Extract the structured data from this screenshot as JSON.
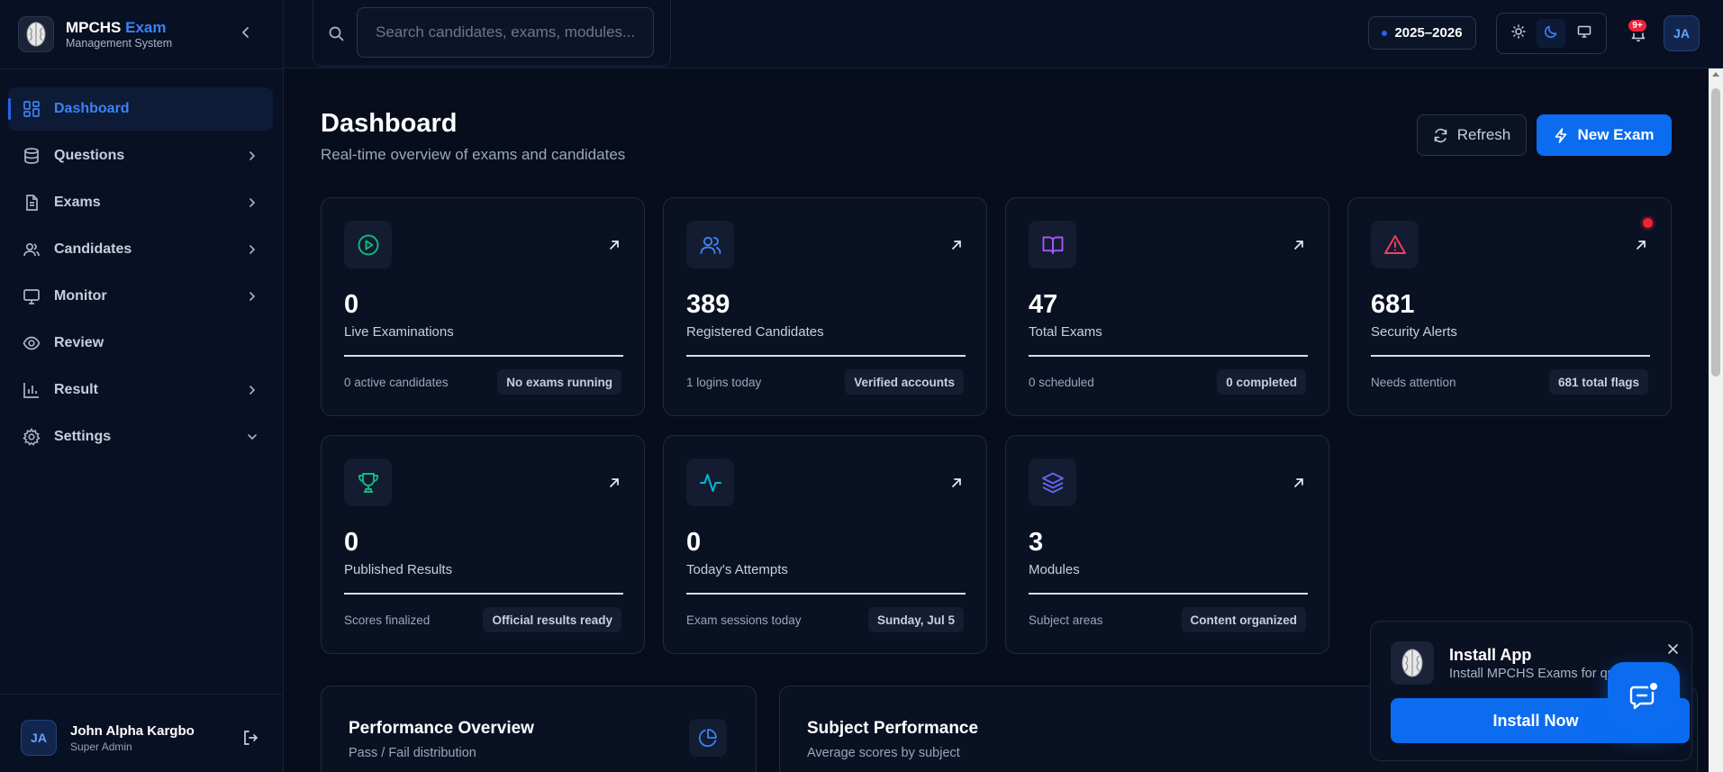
{
  "brand": {
    "name": "MPCHS",
    "name_accent": "Exam",
    "subtitle": "Management System"
  },
  "sidebar": {
    "items": [
      {
        "label": "Dashboard",
        "icon": "dashboard-grid-icon",
        "active": true,
        "chevron": "none"
      },
      {
        "label": "Questions",
        "icon": "database-icon",
        "chevron": "right"
      },
      {
        "label": "Exams",
        "icon": "file-text-icon",
        "chevron": "right"
      },
      {
        "label": "Candidates",
        "icon": "users-icon",
        "chevron": "right"
      },
      {
        "label": "Monitor",
        "icon": "monitor-icon",
        "chevron": "right"
      },
      {
        "label": "Review",
        "icon": "eye-icon",
        "chevron": "none"
      },
      {
        "label": "Result",
        "icon": "bar-chart-icon",
        "chevron": "right"
      },
      {
        "label": "Settings",
        "icon": "gear-icon",
        "chevron": "down"
      }
    ],
    "user": {
      "initials": "JA",
      "name": "John Alpha Kargbo",
      "role": "Super Admin"
    }
  },
  "topbar": {
    "search_placeholder": "Search candidates, exams, modules...",
    "academic_year": "2025–2026",
    "notification_badge": "9+",
    "user_initials": "JA"
  },
  "header": {
    "title": "Dashboard",
    "subtitle": "Real-time overview of exams and candidates",
    "refresh_label": "Refresh",
    "new_exam_label": "New Exam"
  },
  "stats": [
    {
      "value": "0",
      "label": "Live Examinations",
      "foot_left": "0 active candidates",
      "foot_pill": "No exams running",
      "icon": "play-circle-icon",
      "color": "#10b981"
    },
    {
      "value": "389",
      "label": "Registered Candidates",
      "foot_left": "1 logins today",
      "foot_pill": "Verified accounts",
      "icon": "users-icon",
      "color": "#3b82f6"
    },
    {
      "value": "47",
      "label": "Total Exams",
      "foot_left": "0 scheduled",
      "foot_pill": "0 completed",
      "icon": "book-open-icon",
      "color": "#a855f7"
    },
    {
      "value": "681",
      "label": "Security Alerts",
      "foot_left": "Needs attention",
      "foot_pill": "681 total flags",
      "icon": "alert-triangle-icon",
      "color": "#f43f5e"
    },
    {
      "value": "0",
      "label": "Published Results",
      "foot_left": "Scores finalized",
      "foot_pill": "Official results ready",
      "icon": "trophy-icon",
      "color": "#10b981"
    },
    {
      "value": "0",
      "label": "Today's Attempts",
      "foot_left": "Exam sessions today",
      "foot_pill": "Sunday, Jul 5",
      "icon": "activity-icon",
      "color": "#06b6d4"
    },
    {
      "value": "3",
      "label": "Modules",
      "foot_left": "Subject areas",
      "foot_pill": "Content organized",
      "icon": "layers-icon",
      "color": "#6366f1"
    }
  ],
  "panels": [
    {
      "title": "Performance Overview",
      "subtitle": "Pass / Fail distribution",
      "icon": "pie-chart-icon"
    },
    {
      "title": "Subject Performance",
      "subtitle": "Average scores by subject"
    }
  ],
  "install": {
    "title": "Install App",
    "subtitle": "Install MPCHS Exams for qu",
    "button": "Install Now"
  },
  "colors": {
    "accent": "#0b6cf0",
    "alert": "#ef233c",
    "background": "#070d1c"
  }
}
